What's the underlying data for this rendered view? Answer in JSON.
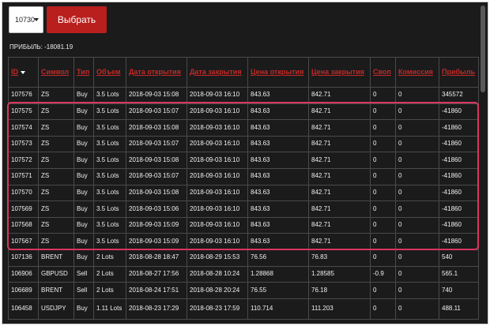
{
  "controls": {
    "select_value": "10730",
    "select_button_label": "Выбрать"
  },
  "profit_summary": "ПРИБЫЛЬ: -18081.19",
  "table": {
    "columns": [
      "ID",
      "Символ",
      "Тип",
      "Объем",
      "Дата открытия",
      "Дата закрытия",
      "Цена открытия",
      "Цена закрытия",
      "Своп",
      "Комиссия",
      "Прибыль"
    ],
    "sort_column": "ID",
    "sort_direction": "descending",
    "rows": [
      [
        "107576",
        "ZS",
        "Buy",
        "3.5 Lots",
        "2018-09-03 15:08",
        "2018-09-03 16:10",
        "843.63",
        "842.71",
        "0",
        "0",
        "345572"
      ],
      [
        "107575",
        "ZS",
        "Buy",
        "3.5 Lots",
        "2018-09-03 15:07",
        "2018-09-03 16:10",
        "843.63",
        "842.71",
        "0",
        "0",
        "-41860"
      ],
      [
        "107574",
        "ZS",
        "Buy",
        "3.5 Lots",
        "2018-09-03 15:08",
        "2018-09-03 16:10",
        "843.63",
        "842.71",
        "0",
        "0",
        "-41860"
      ],
      [
        "107573",
        "ZS",
        "Buy",
        "3.5 Lots",
        "2018-09-03 15:07",
        "2018-09-03 16:10",
        "843.63",
        "842.71",
        "0",
        "0",
        "-41860"
      ],
      [
        "107572",
        "ZS",
        "Buy",
        "3.5 Lots",
        "2018-09-03 15:08",
        "2018-09-03 16:10",
        "843.63",
        "842.71",
        "0",
        "0",
        "-41860"
      ],
      [
        "107571",
        "ZS",
        "Buy",
        "3.5 Lots",
        "2018-09-03 15:07",
        "2018-09-03 16:10",
        "843.63",
        "842.71",
        "0",
        "0",
        "-41860"
      ],
      [
        "107570",
        "ZS",
        "Buy",
        "3.5 Lots",
        "2018-09-03 15:08",
        "2018-09-03 16:10",
        "843.63",
        "842.71",
        "0",
        "0",
        "-41860"
      ],
      [
        "107569",
        "ZS",
        "Buy",
        "3.5 Lots",
        "2018-09-03 15:06",
        "2018-09-03 16:10",
        "843.63",
        "842.71",
        "0",
        "0",
        "-41860"
      ],
      [
        "107568",
        "ZS",
        "Buy",
        "3.5 Lots",
        "2018-09-03 15:09",
        "2018-09-03 16:10",
        "843.63",
        "842.71",
        "0",
        "0",
        "-41860"
      ],
      [
        "107567",
        "ZS",
        "Buy",
        "3.5 Lots",
        "2018-09-03 15:09",
        "2018-09-03 16:10",
        "843.63",
        "842.71",
        "0",
        "0",
        "-41860"
      ],
      [
        "107136",
        "BRENT",
        "Buy",
        "2 Lots",
        "2018-08-28 18:47",
        "2018-08-29 15:53",
        "76.56",
        "76.83",
        "0",
        "0",
        "540"
      ],
      [
        "106906",
        "GBPUSD",
        "Sell",
        "2 Lots",
        "2018-08-27 17:56",
        "2018-08-28 10:24",
        "1.28868",
        "1.28585",
        "-0.9",
        "0",
        "565.1"
      ],
      [
        "106689",
        "BRENT",
        "Sell",
        "2 Lots",
        "2018-08-24 17:51",
        "2018-08-28 20:24",
        "76.55",
        "76.18",
        "0",
        "0",
        "740"
      ],
      [
        "106458",
        "USDJPY",
        "Buy",
        "1.11 Lots",
        "2018-08-23 17:29",
        "2018-08-23 17:59",
        "110.714",
        "111.203",
        "0",
        "0",
        "488.11"
      ]
    ]
  },
  "highlight_color": "#d9365f",
  "accent_color": "#c22a26"
}
